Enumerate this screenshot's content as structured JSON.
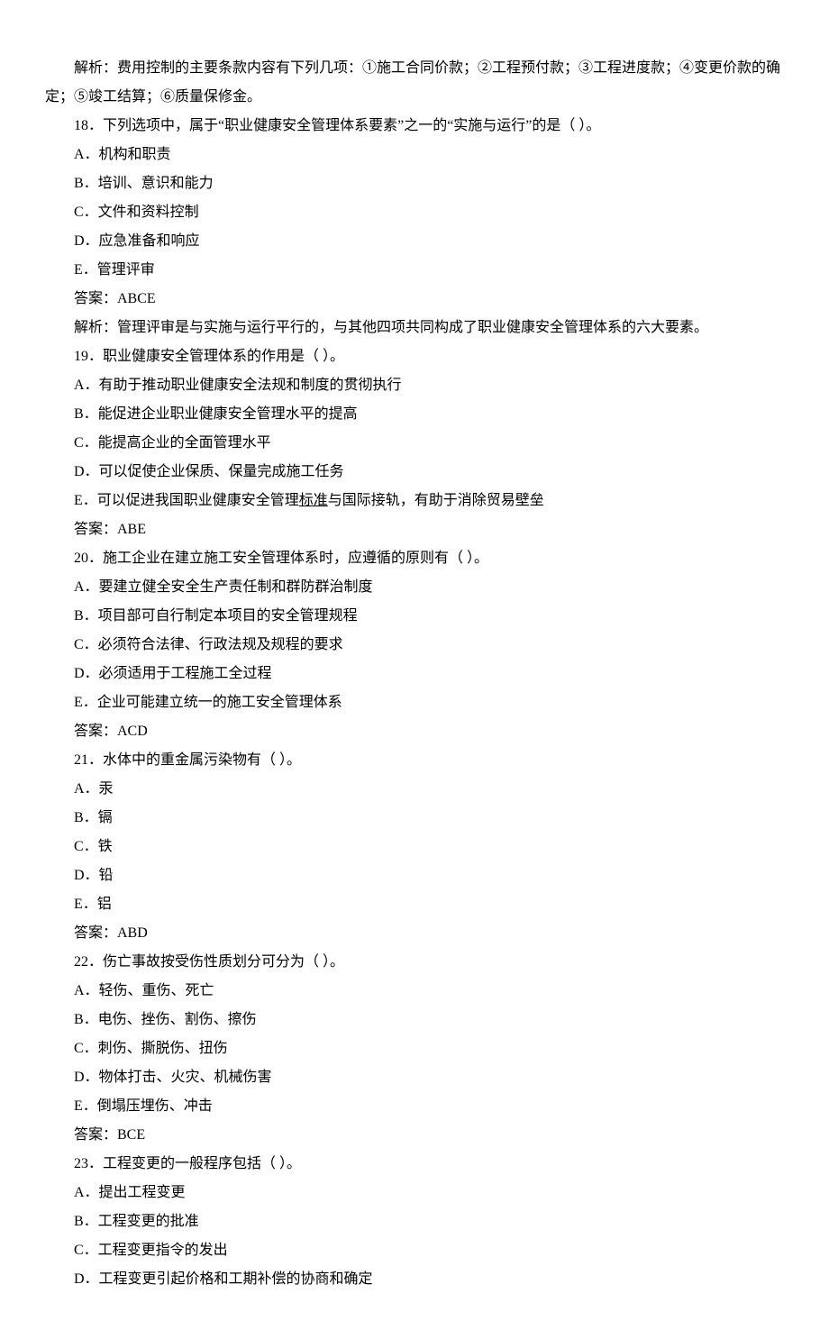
{
  "lines": [
    "解析：费用控制的主要条款内容有下列几项：①施工合同价款；②工程预付款；③工程进度款；④变更价款的确定；⑤竣工结算；⑥质量保修金。",
    "18．下列选项中，属于“职业健康安全管理体系要素”之一的“实施与运行”的是（  ）。",
    "A．机构和职责",
    "B．培训、意识和能力",
    "C．文件和资料控制",
    "D．应急准备和响应",
    "E．管理评审",
    "答案：ABCE",
    "解析：管理评审是与实施与运行平行的，与其他四项共同构成了职业健康安全管理体系的六大要素。",
    "19．职业健康安全管理体系的作用是（  ）。",
    "A．有助于推动职业健康安全法规和制度的贯彻执行",
    "B．能促进企业职业健康安全管理水平的提高",
    "C．能提高企业的全面管理水平",
    "D．可以促使企业保质、保量完成施工任务",
    "E．可以促进我国职业健康安全管理|标准|与国际接轨，有助于消除贸易壁垒",
    "答案：ABE",
    "20．施工企业在建立施工安全管理体系时，应遵循的原则有（  ）。",
    "A．要建立健全安全生产责任制和群防群治制度",
    "B．项目部可自行制定本项目的安全管理规程",
    "C．必须符合法律、行政法规及规程的要求",
    "D．必须适用于工程施工全过程",
    "E．企业可能建立统一的施工安全管理体系",
    "答案：ACD",
    "21．水体中的重金属污染物有（  ）。",
    "A．汞",
    "B．镉",
    "C．铁",
    "D．铅",
    "E．铝",
    "答案：ABD",
    "22．伤亡事故按受伤性质划分可分为（  ）。",
    "A．轻伤、重伤、死亡",
    "B．电伤、挫伤、割伤、擦伤",
    "C．刺伤、撕脱伤、扭伤",
    "D．物体打击、火灾、机械伤害",
    "E．倒塌压埋伤、冲击",
    "答案：BCE",
    "23．工程变更的一般程序包括（  ）。",
    "A．提出工程变更",
    "B．工程变更的批准",
    "C．工程变更指令的发出",
    "D．工程变更引起价格和工期补偿的协商和确定"
  ],
  "firstLineWrap": true
}
